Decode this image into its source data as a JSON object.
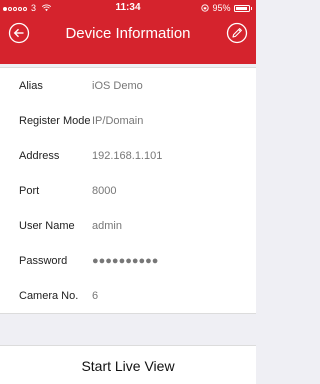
{
  "status_bar": {
    "signal_dots_full": 1,
    "signal_dots_total": 5,
    "carrier_extra": "3",
    "time": "11:34",
    "battery_percent_text": "95%",
    "battery_level": 0.95
  },
  "header": {
    "title": "Device Information",
    "back_icon": "back-arrow-circle-icon",
    "edit_icon": "pencil-circle-icon",
    "color": "#d5232d"
  },
  "fields": [
    {
      "label": "Alias",
      "value": "iOS Demo"
    },
    {
      "label": "Register Mode",
      "value": "IP/Domain"
    },
    {
      "label": "Address",
      "value": "192.168.1.101"
    },
    {
      "label": "Port",
      "value": "8000"
    },
    {
      "label": "User Name",
      "value": "admin"
    },
    {
      "label": "Password",
      "value": "●●●●●●●●●●"
    },
    {
      "label": "Camera No.",
      "value": "6"
    }
  ],
  "bottom": {
    "button_label": "Start Live View"
  }
}
